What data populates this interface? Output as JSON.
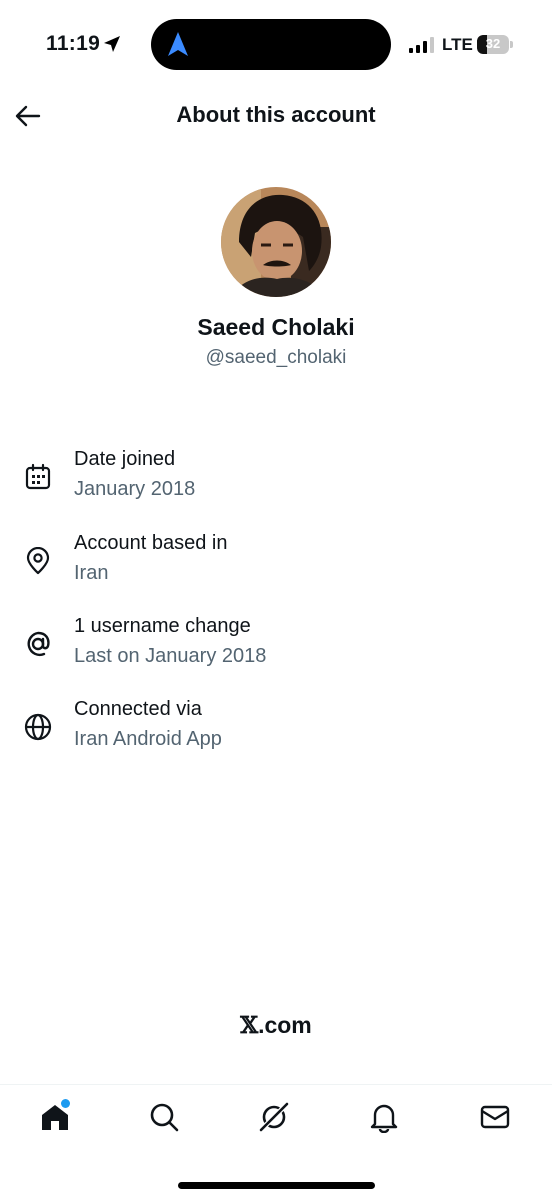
{
  "status_bar": {
    "time": "11:19",
    "network": "LTE",
    "battery_level": "32",
    "battery_fraction": 0.32
  },
  "header": {
    "title": "About this account",
    "back_icon": "arrow-left-icon"
  },
  "profile": {
    "display_name": "Saeed Cholaki",
    "handle": "@saeed_cholaki"
  },
  "info": [
    {
      "icon": "calendar-icon",
      "label": "Date joined",
      "value": "January 2018"
    },
    {
      "icon": "location-pin-icon",
      "label": "Account based in",
      "value": "Iran"
    },
    {
      "icon": "at-sign-icon",
      "label": "1 username change",
      "value": "Last on January 2018"
    },
    {
      "icon": "globe-icon",
      "label": "Connected via",
      "value": "Iran Android App"
    }
  ],
  "footer": {
    "brand_x": "𝕏",
    "brand_suffix": ".com"
  },
  "bottom_nav": {
    "items": [
      "home-icon",
      "search-icon",
      "grok-icon",
      "notifications-icon",
      "messages-icon"
    ],
    "accent": "#1d9bf0"
  },
  "colors": {
    "text_primary": "#0f1419",
    "text_secondary": "#536471",
    "accent": "#1d9bf0"
  }
}
